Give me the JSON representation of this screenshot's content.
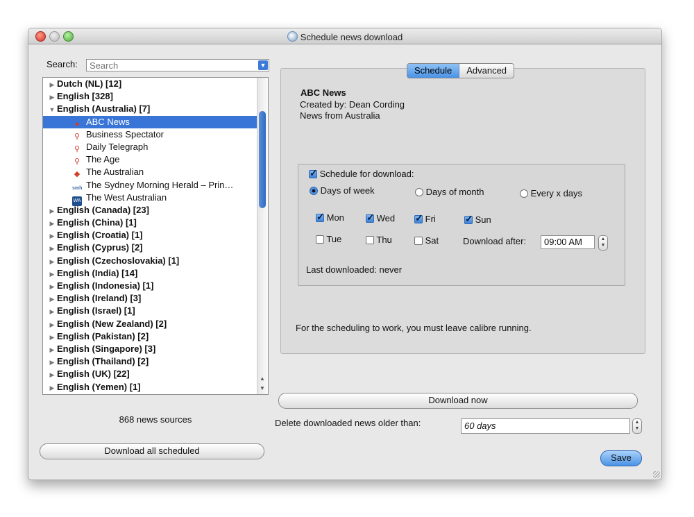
{
  "window": {
    "title": "Schedule news download"
  },
  "search": {
    "label": "Search:",
    "placeholder": "Search"
  },
  "tree": {
    "items_before": [
      {
        "label": "Dutch (NL) [12]",
        "expanded": false
      },
      {
        "label": "English [328]",
        "expanded": false
      },
      {
        "label": "English (Australia) [7]",
        "expanded": true
      }
    ],
    "children": [
      {
        "label": "ABC News",
        "icon": "abc-icon",
        "selected": true
      },
      {
        "label": "Business Spectator",
        "icon": "pin-icon"
      },
      {
        "label": "Daily Telegraph",
        "icon": "pin-icon"
      },
      {
        "label": "The Age",
        "icon": "pin-icon"
      },
      {
        "label": "The Australian",
        "icon": "australia-map-icon"
      },
      {
        "label": "The Sydney Morning Herald – Prin…",
        "icon": "smh-icon"
      },
      {
        "label": "The West Australian",
        "icon": "wa-icon"
      }
    ],
    "items_after": [
      "English (Canada) [23]",
      "English (China) [1]",
      "English (Croatia) [1]",
      "English (Cyprus) [2]",
      "English (Czechoslovakia) [1]",
      "English (India) [14]",
      "English (Indonesia) [1]",
      "English (Ireland) [3]",
      "English (Israel) [1]",
      "English (New Zealand) [2]",
      "English (Pakistan) [2]",
      "English (Singapore) [3]",
      "English (Thailand) [2]",
      "English (UK) [22]",
      "English (Yemen) [1]"
    ]
  },
  "sources_count": "868 news sources",
  "download_all_label": "Download all scheduled",
  "tabs": {
    "schedule": "Schedule",
    "advanced": "Advanced"
  },
  "recipe": {
    "title": "ABC News",
    "author": "Created by: Dean Cording",
    "description": "News from Australia"
  },
  "schedule": {
    "enable_label": "Schedule for download:",
    "mode_week": "Days of  week",
    "mode_month": "Days of month",
    "mode_every": "Every x days",
    "days": {
      "mon": "Mon",
      "wed": "Wed",
      "fri": "Fri",
      "sun": "Sun",
      "tue": "Tue",
      "thu": "Thu",
      "sat": "Sat"
    },
    "download_after_label": "Download after:",
    "download_after_value": "09:00 AM",
    "last_downloaded": "Last downloaded: never"
  },
  "note": "For the scheduling to work, you must leave calibre running.",
  "download_now_label": "Download now",
  "delete_label": "Delete downloaded news older than:",
  "delete_value": "60 days",
  "save_label": "Save"
}
